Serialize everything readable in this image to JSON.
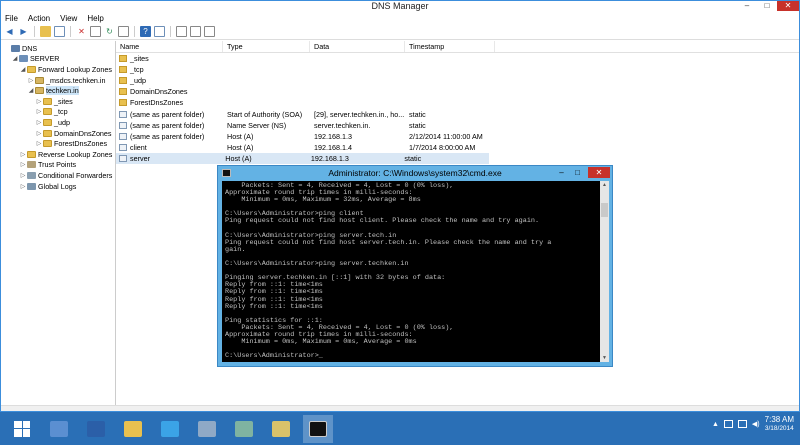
{
  "window": {
    "title": "DNS Manager"
  },
  "menu": [
    "File",
    "Action",
    "View",
    "Help"
  ],
  "tree": [
    {
      "label": "DNS",
      "level": 0,
      "icon": "dns-icon",
      "exp": ""
    },
    {
      "label": "SERVER",
      "level": 1,
      "icon": "server-icon",
      "exp": "◢"
    },
    {
      "label": "Forward Lookup Zones",
      "level": 2,
      "icon": "folder-icon",
      "exp": "◢"
    },
    {
      "label": "_msdcs.techken.in",
      "level": 3,
      "icon": "zone-icon",
      "exp": "▷"
    },
    {
      "label": "techken.in",
      "level": 3,
      "icon": "zone-icon",
      "exp": "◢",
      "selected": true
    },
    {
      "label": "_sites",
      "level": 4,
      "icon": "folder-icon",
      "exp": "▷"
    },
    {
      "label": "_tcp",
      "level": 4,
      "icon": "folder-icon",
      "exp": "▷"
    },
    {
      "label": "_udp",
      "level": 4,
      "icon": "folder-icon",
      "exp": "▷"
    },
    {
      "label": "DomainDnsZones",
      "level": 4,
      "icon": "folder-icon",
      "exp": "▷"
    },
    {
      "label": "ForestDnsZones",
      "level": 4,
      "icon": "folder-icon",
      "exp": "▷"
    },
    {
      "label": "Reverse Lookup Zones",
      "level": 2,
      "icon": "folder-icon",
      "exp": "▷"
    },
    {
      "label": "Trust Points",
      "level": 2,
      "icon": "trust-icon",
      "exp": "▷"
    },
    {
      "label": "Conditional Forwarders",
      "level": 2,
      "icon": "forwarder-icon",
      "exp": "▷"
    },
    {
      "label": "Global Logs",
      "level": 2,
      "icon": "log-icon",
      "exp": "▷"
    }
  ],
  "columns": {
    "name": "Name",
    "type": "Type",
    "data": "Data",
    "timestamp": "Timestamp"
  },
  "records": [
    {
      "name": "_sites",
      "type": "",
      "data": "",
      "timestamp": "",
      "kind": "folder"
    },
    {
      "name": "_tcp",
      "type": "",
      "data": "",
      "timestamp": "",
      "kind": "folder"
    },
    {
      "name": "_udp",
      "type": "",
      "data": "",
      "timestamp": "",
      "kind": "folder"
    },
    {
      "name": "DomainDnsZones",
      "type": "",
      "data": "",
      "timestamp": "",
      "kind": "folder"
    },
    {
      "name": "ForestDnsZones",
      "type": "",
      "data": "",
      "timestamp": "",
      "kind": "folder"
    },
    {
      "name": "(same as parent folder)",
      "type": "Start of Authority (SOA)",
      "data": "[29], server.techken.in., ho...",
      "timestamp": "static",
      "kind": "record"
    },
    {
      "name": "(same as parent folder)",
      "type": "Name Server (NS)",
      "data": "server.techken.in.",
      "timestamp": "static",
      "kind": "record"
    },
    {
      "name": "(same as parent folder)",
      "type": "Host (A)",
      "data": "192.168.1.3",
      "timestamp": "2/12/2014 11:00:00 AM",
      "kind": "record"
    },
    {
      "name": "client",
      "type": "Host (A)",
      "data": "192.168.1.4",
      "timestamp": "1/7/2014 8:00:00 AM",
      "kind": "record"
    },
    {
      "name": "server",
      "type": "Host (A)",
      "data": "192.168.1.3",
      "timestamp": "static",
      "kind": "record",
      "selected": true
    }
  ],
  "cmd": {
    "title": "Administrator: C:\\Windows\\system32\\cmd.exe",
    "lines": [
      "    Packets: Sent = 4, Received = 4, Lost = 0 (0% loss),",
      "Approximate round trip times in milli-seconds:",
      "    Minimum = 0ms, Maximum = 32ms, Average = 8ms",
      "",
      "C:\\Users\\Administrator>ping client",
      "Ping request could not find host client. Please check the name and try again.",
      "",
      "C:\\Users\\Administrator>ping server.tech.in",
      "Ping request could not find host server.tech.in. Please check the name and try a",
      "gain.",
      "",
      "C:\\Users\\Administrator>ping server.techken.in",
      "",
      "Pinging server.techken.in [::1] with 32 bytes of data:",
      "Reply from ::1: time<1ms",
      "Reply from ::1: time<1ms",
      "Reply from ::1: time<1ms",
      "Reply from ::1: time<1ms",
      "",
      "Ping statistics for ::1:",
      "    Packets: Sent = 4, Received = 4, Lost = 0 (0% loss),",
      "Approximate round trip times in milli-seconds:",
      "    Minimum = 0ms, Maximum = 0ms, Average = 0ms",
      "",
      "C:\\Users\\Administrator>_"
    ]
  },
  "taskbar": {
    "apps": [
      {
        "name": "start-button",
        "icon": "windows-logo-icon"
      },
      {
        "name": "server-manager-button",
        "icon": "server-manager-icon",
        "color": "#5b8fd1"
      },
      {
        "name": "powershell-button",
        "icon": "powershell-icon",
        "color": "#2b5fa8"
      },
      {
        "name": "file-explorer-button",
        "icon": "folder-icon",
        "color": "#e8c04f"
      },
      {
        "name": "internet-explorer-button",
        "icon": "ie-icon",
        "color": "#3ba3e6"
      },
      {
        "name": "dns-manager-taskbar-button",
        "icon": "dns-manager-icon",
        "color": "#8fa9c6"
      },
      {
        "name": "network-taskbar-button",
        "icon": "network-icon",
        "color": "#7fb3a1"
      },
      {
        "name": "notes-taskbar-button",
        "icon": "notepad-icon",
        "color": "#d9c26a"
      },
      {
        "name": "cmd-taskbar-button",
        "icon": "cmd-icon",
        "color": "#111111",
        "active": true
      }
    ],
    "time": "7:38 AM",
    "date": "3/18/2014"
  }
}
